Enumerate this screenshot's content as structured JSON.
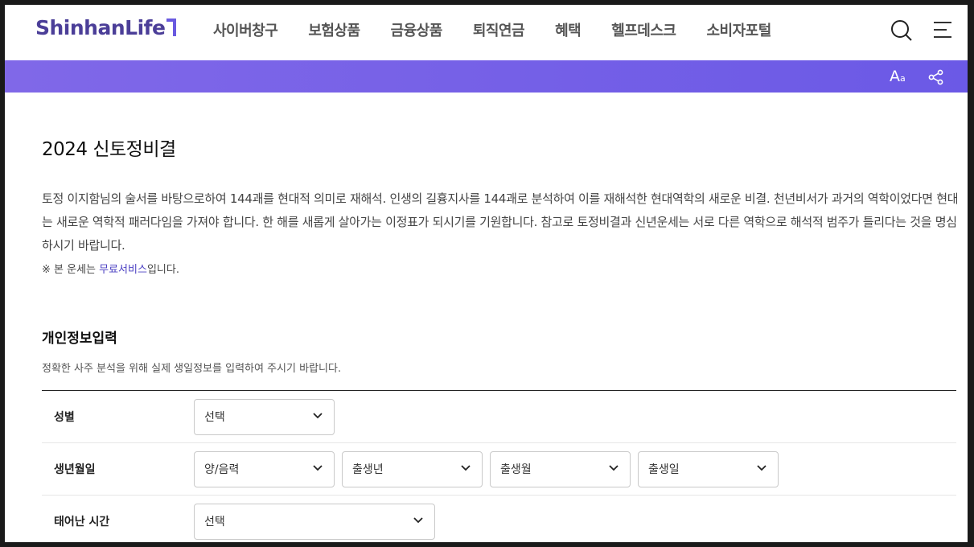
{
  "header": {
    "logo": "ShinhanLife",
    "nav": [
      "사이버창구",
      "보험상품",
      "금융상품",
      "퇴직연금",
      "혜택",
      "헬프데스크",
      "소비자포털"
    ]
  },
  "util": {
    "font_size_label": "A",
    "font_size_small": "a"
  },
  "main": {
    "title": "2024 신토정비결",
    "description": "토정 이지함님의 술서를 바탕으로하여 144괘를 현대적 의미로 재해석. 인생의 길흉지사를 144괘로 분석하여 이를 재해석한 현대역학의 새로운 비결. 천년비서가 과거의 역학이었다면 현대는 새로운 역학적 패러다임을 가져야 합니다. 한 해를 새롭게 살아가는 이정표가 되시기를 기원합니다. 참고로 토정비결과 신년운세는 서로 다른 역학으로 해석적 범주가 틀리다는 것을 명심하시기 바랍니다.",
    "note_prefix": "※ 본 운세는 ",
    "note_link": "무료서비스",
    "note_suffix": "입니다."
  },
  "form": {
    "title": "개인정보입력",
    "subtitle": "정확한 사주 분석을 위해 실제 생일정보를 입력하여 주시기 바랍니다.",
    "rows": [
      {
        "label": "성별",
        "selects": [
          "선택"
        ]
      },
      {
        "label": "생년월일",
        "selects": [
          "양/음력",
          "출생년",
          "출생월",
          "출생일"
        ]
      },
      {
        "label": "태어난 시간",
        "selects": [
          "선택"
        ]
      }
    ]
  }
}
